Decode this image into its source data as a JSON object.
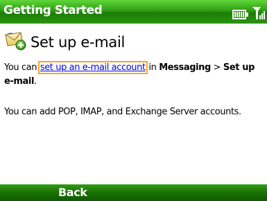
{
  "title_bar": {
    "title": "Getting Started",
    "battery_icon": "battery-icon",
    "signal_icon": "signal-icon"
  },
  "content": {
    "heading": "Set up e-mail",
    "heading_icon": "email-setup-icon",
    "paragraph1": {
      "before_link": "You can ",
      "link_text": "set up an e-mail account",
      "after_link": " in ",
      "bold1": "Messaging",
      "separator": " > ",
      "bold2": "Set up e-mail",
      "end": "."
    },
    "paragraph2": "You can add POP, IMAP, and Exchange Server accounts."
  },
  "softkeys": {
    "left": "Back"
  },
  "colors": {
    "title_bar": "#2f9d14",
    "link": "#0000ee",
    "focus_outline": "#f5a623"
  }
}
